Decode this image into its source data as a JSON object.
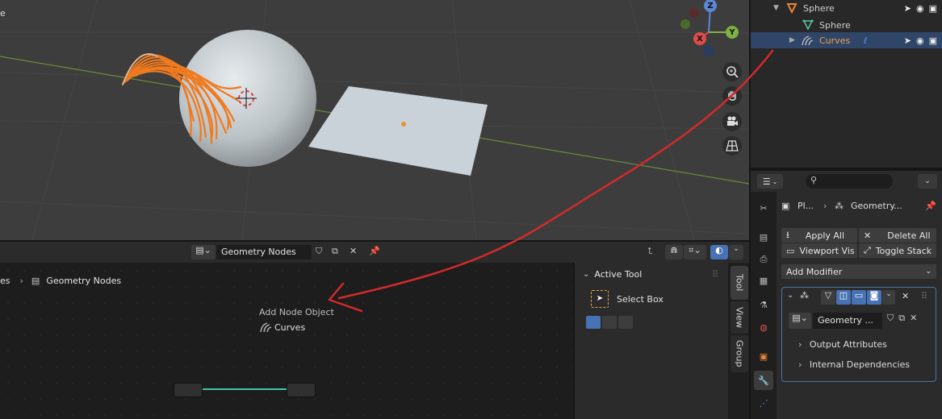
{
  "viewport": {
    "edge_label": "e",
    "gizmo": {
      "x": "X",
      "y": "Y",
      "z": "Z"
    },
    "nav_icons": [
      "zoom-icon",
      "hand-pan-icon",
      "camera-icon",
      "grid-icon"
    ]
  },
  "outliner": {
    "rows": [
      {
        "label": "Sphere",
        "icon": "object-triangle-icon"
      },
      {
        "label": "Sphere",
        "icon": "mesh-data-icon"
      },
      {
        "label": "Curves",
        "icon": "curves-icon"
      }
    ]
  },
  "properties": {
    "breadcrumb_obj": "Pl...",
    "breadcrumb_mod": "Geometry...",
    "apply_all": "Apply All",
    "delete_all": "Delete All",
    "viewport_vis": "Viewport Vis",
    "toggle_stack": "Toggle Stack",
    "add_modifier": "Add Modifier",
    "node_group": "Geometry ...",
    "output_attributes": "Output Attributes",
    "internal_dependencies": "Internal Dependencies"
  },
  "node_header": {
    "tree_name": "Geometry Nodes"
  },
  "node_editor": {
    "breadcrumb_prefix": "es",
    "breadcrumb_name": "Geometry Nodes",
    "hint_title": "Add Node Object",
    "hint_object": "Curves"
  },
  "n_panel": {
    "section_title": "Active Tool",
    "tool_name": "Select Box",
    "tabs": [
      "Tool",
      "View",
      "Group"
    ]
  },
  "colors": {
    "accent": "#4772b3",
    "selection": "#2f4668",
    "curves_orange": "#f07a1e",
    "annotation_red": "#d42a2a",
    "link_teal": "#3ec9a7"
  }
}
